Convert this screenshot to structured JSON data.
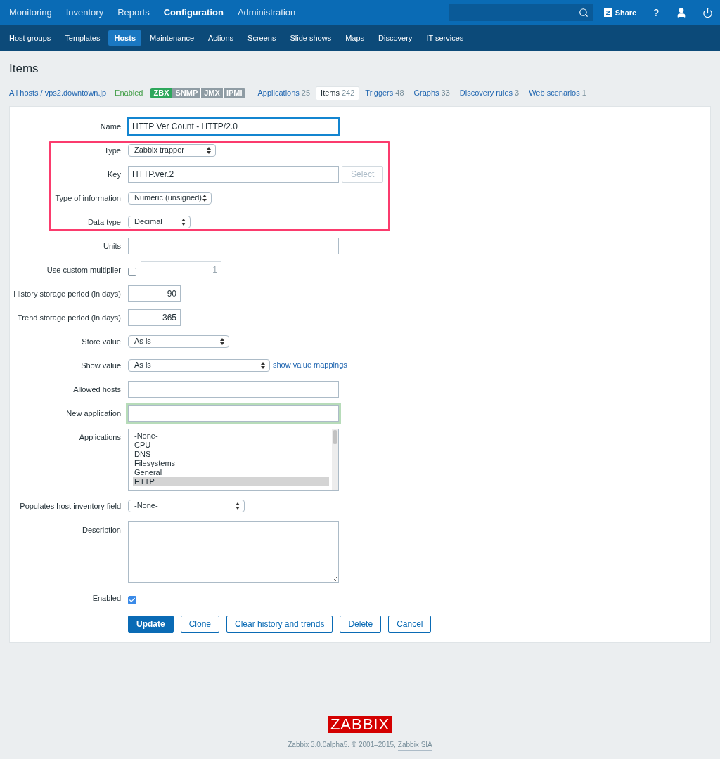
{
  "top_nav": {
    "items": [
      {
        "label": "Monitoring",
        "selected": false
      },
      {
        "label": "Inventory",
        "selected": false
      },
      {
        "label": "Reports",
        "selected": false
      },
      {
        "label": "Configuration",
        "selected": true
      },
      {
        "label": "Administration",
        "selected": false
      }
    ],
    "share": "Share",
    "help": "?"
  },
  "sub_nav": {
    "items": [
      {
        "label": "Host groups",
        "selected": false
      },
      {
        "label": "Templates",
        "selected": false
      },
      {
        "label": "Hosts",
        "selected": true
      },
      {
        "label": "Maintenance",
        "selected": false
      },
      {
        "label": "Actions",
        "selected": false
      },
      {
        "label": "Screens",
        "selected": false
      },
      {
        "label": "Slide shows",
        "selected": false
      },
      {
        "label": "Maps",
        "selected": false
      },
      {
        "label": "Discovery",
        "selected": false
      },
      {
        "label": "IT services",
        "selected": false
      }
    ]
  },
  "page_title": "Items",
  "breadcrumb": {
    "all_hosts": "All hosts",
    "separator": "/",
    "host": "vps2.downtown.jp",
    "status": "Enabled",
    "tags": [
      {
        "label": "ZBX",
        "available": true
      },
      {
        "label": "SNMP",
        "available": false
      },
      {
        "label": "JMX",
        "available": false
      },
      {
        "label": "IPMI",
        "available": false
      }
    ]
  },
  "tabs": [
    {
      "label": "Applications",
      "count": "25",
      "selected": false
    },
    {
      "label": "Items",
      "count": "242",
      "selected": true
    },
    {
      "label": "Triggers",
      "count": "48",
      "selected": false
    },
    {
      "label": "Graphs",
      "count": "33",
      "selected": false
    },
    {
      "label": "Discovery rules",
      "count": "3",
      "selected": false
    },
    {
      "label": "Web scenarios",
      "count": "1",
      "selected": false
    }
  ],
  "form": {
    "sections": [
      {
        "highlighted": false,
        "rows": [
          {
            "kind": "text",
            "label": "Name",
            "value": "HTTP Ver Count - HTTP/2.0",
            "focused": true
          }
        ]
      },
      {
        "highlighted": true,
        "rows": [
          {
            "kind": "select",
            "label": "Type",
            "value": "Zabbix trapper"
          },
          {
            "kind": "text",
            "label": "Key",
            "value": "HTTP.ver.2",
            "button": "Select"
          },
          {
            "kind": "select",
            "label": "Type of information",
            "value": "Numeric (unsigned)"
          },
          {
            "kind": "select",
            "label": "Data type",
            "value": "Decimal"
          }
        ]
      },
      {
        "highlighted": false,
        "rows": [
          {
            "kind": "text",
            "label": "Units"
          },
          {
            "kind": "multiplier",
            "label": "Use custom multiplier",
            "checked": false,
            "value": "1"
          },
          {
            "kind": "number",
            "label": "History storage period (in days)",
            "value": "90"
          },
          {
            "kind": "number",
            "label": "Trend storage period (in days)",
            "value": "365"
          },
          {
            "kind": "select",
            "label": "Store value",
            "value": "As is"
          },
          {
            "kind": "select",
            "label": "Show value",
            "value": "As is",
            "link": "show value mappings"
          },
          {
            "kind": "text",
            "label": "Allowed hosts"
          },
          {
            "kind": "text",
            "label": "New application",
            "valid": true
          },
          {
            "kind": "listbox",
            "label": "Applications",
            "options": [
              {
                "label": "-None-",
                "selected": false
              },
              {
                "label": "CPU",
                "selected": false
              },
              {
                "label": "DNS",
                "selected": false
              },
              {
                "label": "Filesystems",
                "selected": false
              },
              {
                "label": "General",
                "selected": false
              },
              {
                "label": "HTTP",
                "selected": true
              }
            ]
          },
          {
            "kind": "select",
            "label": "Populates host inventory field",
            "value": "-None-"
          },
          {
            "kind": "textarea",
            "label": "Description"
          },
          {
            "kind": "checkbox",
            "label": "Enabled",
            "checked": true
          }
        ]
      }
    ],
    "buttons": [
      {
        "label": "Update",
        "primary": true
      },
      {
        "label": "Clone",
        "primary": false
      },
      {
        "label": "Clear history and trends",
        "primary": false
      },
      {
        "label": "Delete",
        "primary": false
      },
      {
        "label": "Cancel",
        "primary": false
      }
    ]
  },
  "footer": {
    "logo": "ZABBIX",
    "copyright": "Zabbix 3.0.0alpha5. © 2001–2015,",
    "company": "Zabbix SIA"
  }
}
